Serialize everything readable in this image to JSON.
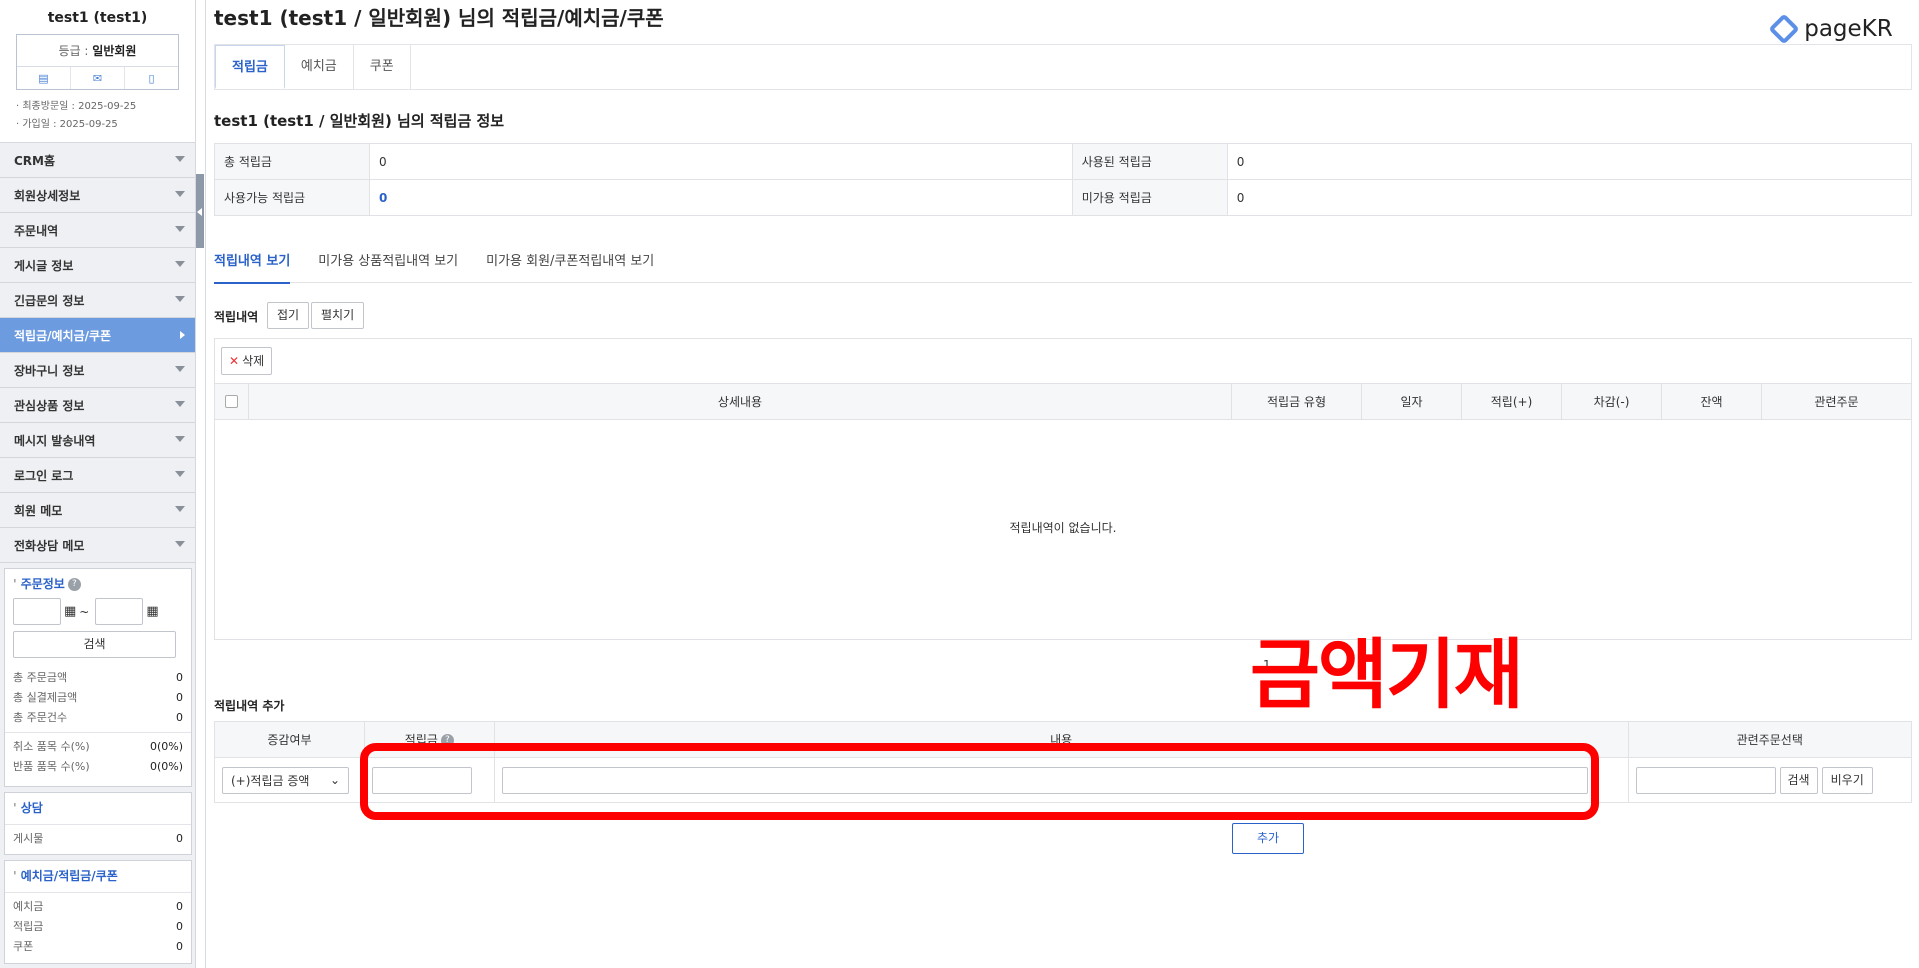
{
  "profile": {
    "name": "test1 (test1)",
    "grade_label": "등급 : ",
    "grade_value": "일반회원",
    "last_visit": "· 최종방문일 : 2025-09-25",
    "join_date": "· 가입일 : 2025-09-25"
  },
  "menu": [
    "CRM홈",
    "회원상세정보",
    "주문내역",
    "게시글 정보",
    "긴급문의 정보",
    "적립금/예치금/쿠폰",
    "장바구니 정보",
    "관심상품 정보",
    "메시지 발송내역",
    "로그인 로그",
    "회원 메모",
    "전화상담 메모"
  ],
  "order_panel": {
    "title": "주문정보",
    "help": "?",
    "range_sep": "~",
    "search": "검색",
    "rows": [
      [
        "총 주문금액",
        "0"
      ],
      [
        "총 실결제금액",
        "0"
      ],
      [
        "총 주문건수",
        "0"
      ]
    ],
    "rows2": [
      [
        "취소 품목 수(%)",
        "0(0%)"
      ],
      [
        "반품 품목 수(%)",
        "0(0%)"
      ]
    ]
  },
  "consult_panel": {
    "title": "상담",
    "rows": [
      [
        "게시물",
        "0"
      ]
    ]
  },
  "deposit_panel": {
    "title": "예치금/적립금/쿠폰",
    "rows": [
      [
        "예치금",
        "0"
      ],
      [
        "적립금",
        "0"
      ],
      [
        "쿠폰",
        "0"
      ]
    ]
  },
  "page_title": "test1 (test1 / 일반회원) 님의 적립금/예치금/쿠폰",
  "logo_text": "pageKR",
  "tabs": [
    "적립금",
    "예치금",
    "쿠폰"
  ],
  "info_title": "test1 (test1 / 일반회원) 님의 적립금 정보",
  "info": {
    "total_label": "총 적립금",
    "total_value": "0",
    "used_label": "사용된 적립금",
    "used_value": "0",
    "avail_label": "사용가능 적립금",
    "avail_value": "0",
    "unused_label": "미가용 적립금",
    "unused_value": "0"
  },
  "subtabs": [
    "적립내역 보기",
    "미가용 상품적립내역 보기",
    "미가용 회원/쿠폰적립내역 보기"
  ],
  "history": {
    "label": "적립내역",
    "collapse": "접기",
    "expand": "펼치기",
    "delete": "삭제",
    "columns": [
      "상세내용",
      "적립금 유형",
      "일자",
      "적립(+)",
      "차감(-)",
      "잔액",
      "관련주문"
    ],
    "empty": "적립내역이 없습니다.",
    "page": "1"
  },
  "add_section": {
    "title": "적립내역 추가",
    "columns": [
      "증감여부",
      "적립금",
      "내용",
      "관련주문선택"
    ],
    "help": "?",
    "select_value": "(+)적립금 증액",
    "search": "검색",
    "clear": "비우기",
    "add": "추가"
  },
  "annotation": "금액기재",
  "colors": {
    "accent": "#2a62c9",
    "active_menu": "#6d9be0",
    "annotation": "#ff0000"
  }
}
